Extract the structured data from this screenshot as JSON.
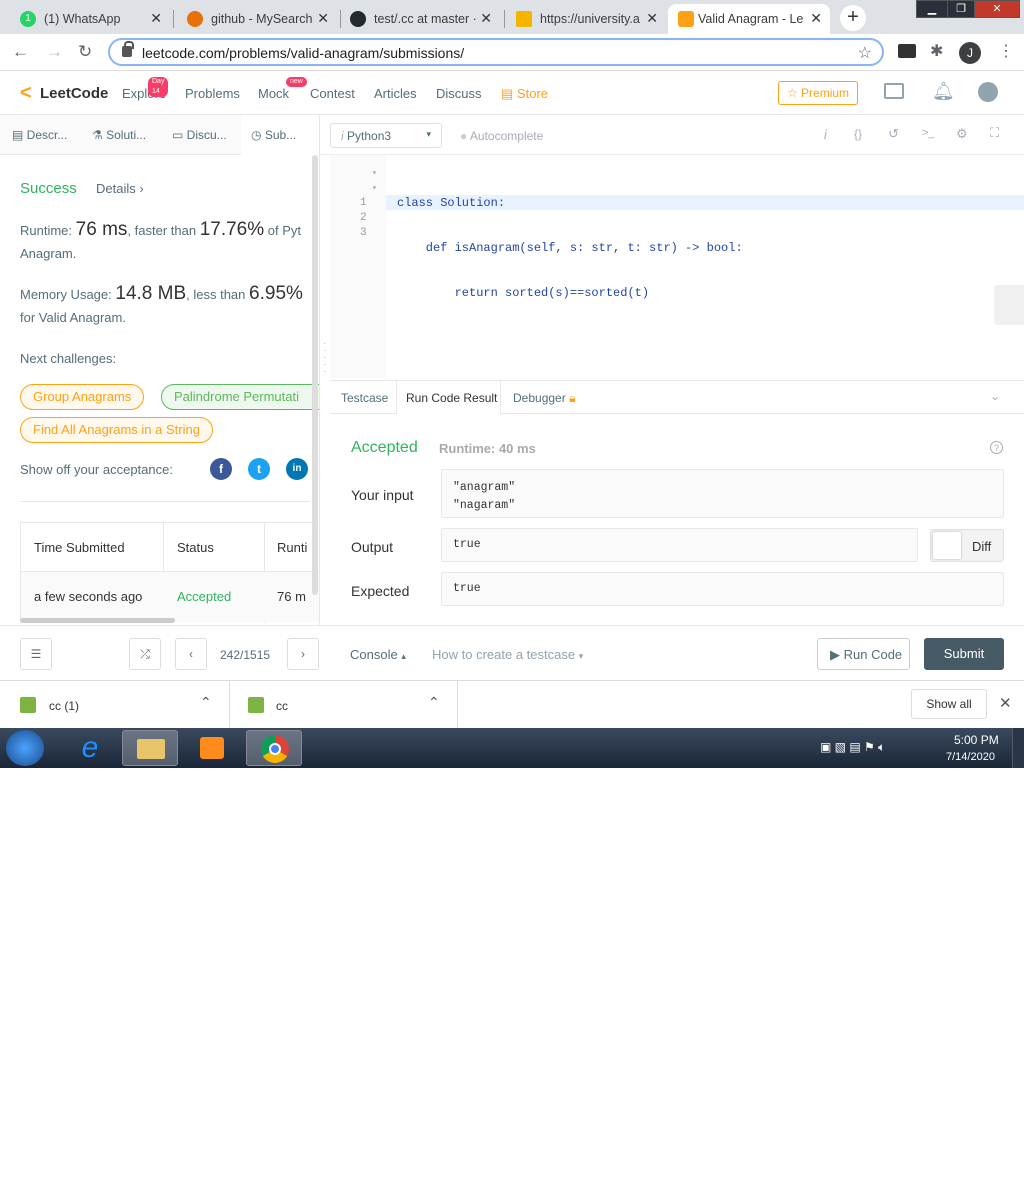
{
  "browser": {
    "tabs": [
      {
        "title": "(1) WhatsApp",
        "color": "#25d366",
        "active": false
      },
      {
        "title": "github - MySearch",
        "color": "#e8710a",
        "active": false
      },
      {
        "title": "test/.cc at master ·",
        "color": "#24292e",
        "active": false
      },
      {
        "title": "https://university.a",
        "color": "#f4b400",
        "active": false
      },
      {
        "title": "Valid Anagram - Le",
        "color": "#ffa116",
        "active": true
      }
    ],
    "url": "leetcode.com/problems/valid-anagram/submissions/",
    "profile_initial": "J"
  },
  "lc_nav": {
    "logo": "LeetCode",
    "items": [
      "Explore",
      "Problems",
      "Mock",
      "Contest",
      "Articles",
      "Discuss",
      "Store"
    ],
    "explore_badge": "Day 14",
    "mock_badge": "new",
    "premium": "Premium"
  },
  "left_tabs": [
    "Descr...",
    "Soluti...",
    "Discu...",
    "Sub..."
  ],
  "submission": {
    "status": "Success",
    "details": "Details",
    "runtime_label": "Runtime:",
    "runtime": "76 ms",
    "faster_than": ", faster than",
    "runtime_pct": "17.76%",
    "runtime_tail": "of Pyt",
    "runtime_line2": "Anagram.",
    "memory_label": "Memory Usage:",
    "memory": "14.8 MB",
    "less_than": ", less than",
    "memory_pct": "6.95%",
    "memory_line2": "for Valid Anagram.",
    "next_challenges": "Next challenges:",
    "challenges": [
      "Group Anagrams",
      "Palindrome Permutati",
      "Find All Anagrams in a String"
    ],
    "show_off": "Show off your acceptance:",
    "table_headers": [
      "Time Submitted",
      "Status",
      "Runti"
    ],
    "table_row": [
      "a few seconds ago",
      "Accepted",
      "76 m"
    ]
  },
  "editor_toolbar": {
    "language": "Python3",
    "autocomplete": "Autocomplete"
  },
  "code": {
    "line_numbers": [
      "1",
      "2",
      "3"
    ],
    "lines": [
      "class Solution:",
      "    def isAnagram(self, s: str, t: str) -> bool:",
      "        return sorted(s)==sorted(t)"
    ]
  },
  "result_tabs": [
    "Testcase",
    "Run Code Result",
    "Debugger"
  ],
  "result": {
    "status": "Accepted",
    "runtime": "Runtime: 40 ms",
    "input_label": "Your input",
    "input_lines": [
      "\"anagram\"",
      "\"nagaram\""
    ],
    "output_label": "Output",
    "output": "true",
    "diff": "Diff",
    "expected_label": "Expected",
    "expected": "true"
  },
  "bottom": {
    "pager": "242/1515",
    "console": "Console",
    "testcase_help": "How to create a testcase",
    "run_code": "Run Code",
    "submit": "Submit"
  },
  "downloads": {
    "items": [
      "cc (1)",
      "cc"
    ],
    "show_all": "Show all"
  },
  "taskbar": {
    "time": "5:00 PM",
    "date": "7/14/2020"
  }
}
